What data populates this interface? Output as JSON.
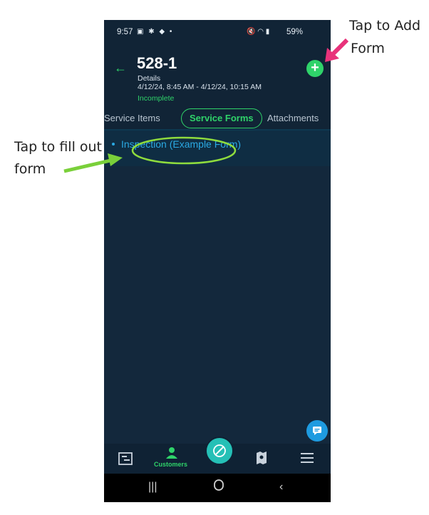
{
  "annotations": {
    "add_form_line1": "Tap to Add",
    "add_form_line2": "Form",
    "fill_form_line1": "Tap to fill out",
    "fill_form_line2": "form"
  },
  "status_bar": {
    "time": "9:57",
    "left_icons": "▣ ✱ ◆ •",
    "right_icons": "🔇 ◠ ▮",
    "battery": "59%"
  },
  "header": {
    "back_icon": "←",
    "title": "528-1",
    "detail_label": "Details",
    "time_range": "4/12/24, 8:45 AM - 4/12/24, 10:15 AM",
    "status": "Incomplete",
    "add_icon": "+"
  },
  "tabs": [
    {
      "label": "Service Items"
    },
    {
      "label": "Service Forms"
    },
    {
      "label": "Attachments"
    }
  ],
  "forms": [
    {
      "name": "Inspection (Example Form)"
    }
  ],
  "bottom_nav": {
    "customers_label": "Customers"
  },
  "colors": {
    "accent_green": "#2fd36a",
    "link_blue": "#2aa9e3",
    "annotation_pink": "#e8327a",
    "annotation_green": "#7ad03a"
  }
}
